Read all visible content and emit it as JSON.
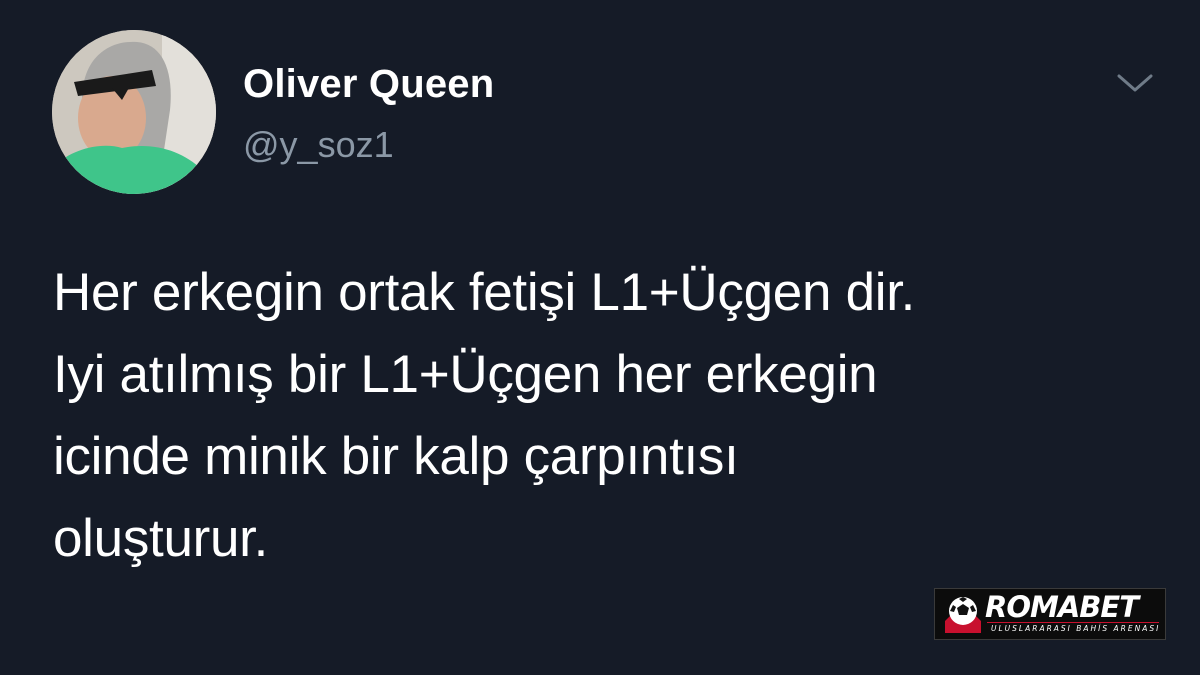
{
  "tweet": {
    "author": {
      "display_name": "Oliver Queen",
      "handle": "@y_soz1",
      "avatar_icon": "profile-photo"
    },
    "menu_icon": "chevron-down-icon",
    "text_lines": [
      "Her erkegin ortak fetişi L1+Üçgen dir.",
      "Iyi atılmış bir L1+Üçgen her erkegin",
      "icinde minik bir kalp çarpıntısı",
      "oluşturur."
    ]
  },
  "watermark": {
    "brand": "ROMABET",
    "tagline": "ULUSLARARASI BAHİS ARENASI",
    "accent_color": "#c8102e"
  },
  "colors": {
    "background": "#151b27",
    "primary_text": "#ffffff",
    "secondary_text": "#8b98a6"
  }
}
